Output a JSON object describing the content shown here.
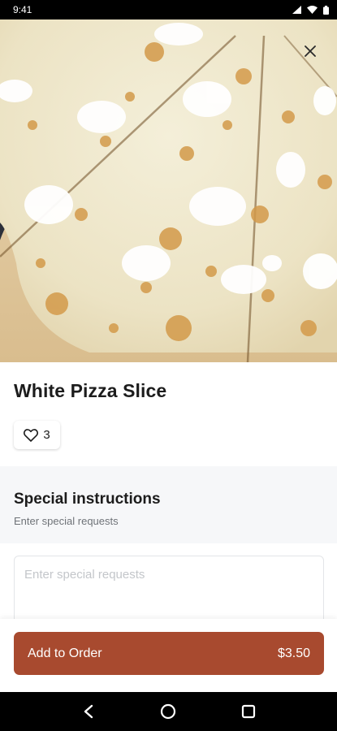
{
  "status_bar": {
    "time": "9:41"
  },
  "item": {
    "title": "White Pizza Slice",
    "likes": "3"
  },
  "instructions": {
    "title": "Special instructions",
    "subtitle": "Enter special requests",
    "placeholder": "Enter special requests",
    "value": ""
  },
  "order": {
    "button_label": "Add to Order",
    "price": "$3.50"
  },
  "colors": {
    "accent": "#a84a2f",
    "section_bg": "#f6f7f9"
  },
  "icons": [
    "signal-icon",
    "wifi-icon",
    "battery-icon",
    "close-icon",
    "heart-icon",
    "back-icon",
    "home-icon",
    "recents-icon"
  ]
}
